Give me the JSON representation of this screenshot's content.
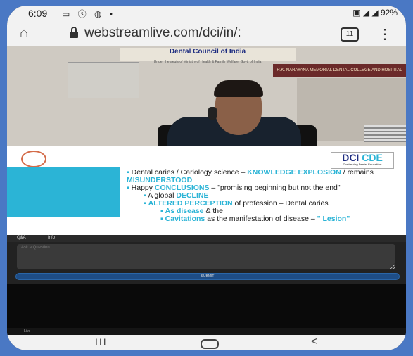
{
  "status": {
    "time": "6:09",
    "left_icons": "▭ ⓢ ◍ •",
    "right": "▣ ◢ ◢ 92%"
  },
  "browser": {
    "url": "webstreamlive.com/dci/in/:",
    "tab_count": "11",
    "home_icon": "⌂",
    "menu_icon": "⋮"
  },
  "video": {
    "banner_title": "Dental Council of India",
    "banner_subtitle": "Under the aegis of Ministry of Health & Family Welfare, Govt. of India",
    "college_sign": "R.K. NARAYANA MEMORIAL DENTAL COLLEGE AND HOSPITAL"
  },
  "slide": {
    "logo_dci": "DCI",
    "logo_cde": "CDE",
    "logo_sub": "Continuing Dental Education",
    "b1_pre": "Dental caries / Cariology science – ",
    "b1_hl1": "KNOWLEDGE EXPLOSION",
    "b1_mid": " / remains ",
    "b1_hl2": "MISUNDERSTOOD",
    "b2_pre": "Happy ",
    "b2_hl": "CONCLUSIONS",
    "b2_post": " – \"promising beginning but not the end\"",
    "b3_pre": "A global ",
    "b3_hl": "DECLINE",
    "b4_hl": "ALTERED PERCEPTION",
    "b4_post": " of profession – Dental caries",
    "b5_hl": "As disease",
    "b5_post": " & the",
    "b6_hl": "Cavitations",
    "b6_post": " as the manifestation of disease – ",
    "b6_hl2": "\" Lesion\""
  },
  "tabs": {
    "qa": "Q&A",
    "info": "Info"
  },
  "qa": {
    "placeholder": "Ask a Question",
    "submit": "SUBMIT"
  },
  "live": {
    "label": "Live"
  },
  "nav": {
    "recent": "III",
    "back": "<"
  }
}
